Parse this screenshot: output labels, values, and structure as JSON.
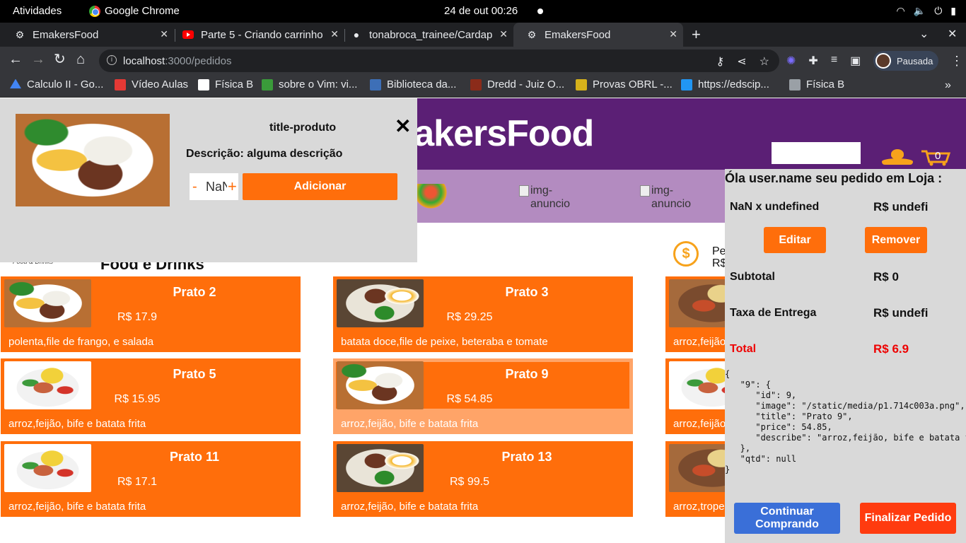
{
  "system": {
    "activities": "Atividades",
    "app_name": "Google Chrome",
    "clock": "24 de out  00:26"
  },
  "tabs": [
    {
      "label": "EmakersFood"
    },
    {
      "label": "Parte 5 - Criando carrinho"
    },
    {
      "label": "tonabroca_trainee/Cardap"
    },
    {
      "label": "EmakersFood"
    }
  ],
  "toolbar": {
    "url_host": "localhost",
    "url_path": ":3000/pedidos",
    "profile_label": "Pausada"
  },
  "bookmarks": [
    {
      "label": "Calculo II - Go...",
      "color": "#4285f4"
    },
    {
      "label": "Vídeo Aulas",
      "color": "#e53935"
    },
    {
      "label": "Física B",
      "color": "#ffffff"
    },
    {
      "label": "sobre o Vim: vi...",
      "color": "#3a9b3a"
    },
    {
      "label": "Biblioteca da...",
      "color": "#3d6fb7"
    },
    {
      "label": "Dredd - Juiz O...",
      "color": "#8b2b1a"
    },
    {
      "label": "Provas OBRL -...",
      "color": "#d6b21b"
    },
    {
      "label": "https://edscip...",
      "color": "#2196f3"
    },
    {
      "label": "Física B",
      "color": "#9aa0a6"
    }
  ],
  "header": {
    "brand": "makersFood",
    "cart_count": "0"
  },
  "ads": [
    {
      "alt": "img-anuncio"
    },
    {
      "alt": "img-anuncio"
    }
  ],
  "section": {
    "title": "Food e Drinks",
    "logo_text": "Food & Drinks",
    "min_order_label": "Pe\nR$"
  },
  "products": [
    {
      "name": "Prato 2",
      "price": "R$ 17.9",
      "desc": "polenta,file de frango, e salada",
      "img": "food-a"
    },
    {
      "name": "Prato 3",
      "price": "R$ 29.25",
      "desc": "batata doce,file de peixe, beteraba e tomate",
      "img": "food-b"
    },
    {
      "name": "",
      "price": "",
      "desc": "arroz,feijão",
      "img": "food-d"
    },
    {
      "name": "Prato 5",
      "price": "R$ 15.95",
      "desc": "arroz,feijão, bife e batata frita",
      "img": "food-c"
    },
    {
      "name": "Prato 9",
      "price": "R$ 54.85",
      "desc": "arroz,feijão, bife e batata frita",
      "img": "food-a"
    },
    {
      "name": "",
      "price": "",
      "desc": "arroz,feijão",
      "img": "food-c"
    },
    {
      "name": "Prato 11",
      "price": "R$ 17.1",
      "desc": "arroz,feijão, bife e batata frita",
      "img": "food-c"
    },
    {
      "name": "Prato 13",
      "price": "R$ 99.5",
      "desc": "arroz,feijão, bife e batata frita",
      "img": "food-b"
    },
    {
      "name": "",
      "price": "",
      "desc": "arroz,trope",
      "img": "food-d"
    }
  ],
  "modal": {
    "title": "title-produto",
    "description": "Descrição: alguma descrição",
    "minus": "-",
    "qty": "NaN",
    "plus": "+",
    "add_label": "Adicionar"
  },
  "cart": {
    "greeting": "Óla user.name seu pedido em Loja :",
    "item_label": "NaN x undefined",
    "item_value": "R$ undefi",
    "edit_label": "Editar",
    "remove_label": "Remover",
    "subtotal_label": "Subtotal",
    "subtotal_value": "R$ 0",
    "delivery_label": "Taxa de Entrega",
    "delivery_value": "R$ undefi",
    "total_label": "Total",
    "total_value": "R$ 6.9",
    "json_dump": "{\n   \"9\": {\n      \"id\": 9,\n      \"image\": \"/static/media/p1.714c003a.png\",\n      \"title\": \"Prato 9\",\n      \"price\": 54.85,\n      \"describe\": \"arroz,feijão, bife e batata frita\"\n   },\n   \"qtd\": null\n}",
    "continue_label": "Continuar Comprando",
    "finish_label": "Finalizar Pedido"
  },
  "colors": {
    "brand_purple": "#5b1f75",
    "accent_orange": "#ff6e0b",
    "total_red": "#e00000"
  }
}
